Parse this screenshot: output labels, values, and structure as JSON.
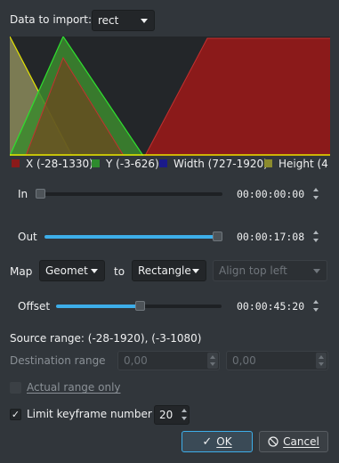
{
  "import_label": "Data to import:",
  "import_value": "rect",
  "chart": {
    "legend": [
      {
        "label": "X (-28-1330)",
        "color": "#8b1a1a"
      },
      {
        "label": "Y (-3-626)",
        "color": "#2e8b2e"
      },
      {
        "label": "Width (727-1920)",
        "color": "#1a1a8b"
      },
      {
        "label": "Height (4",
        "color": "#8b8b2e"
      }
    ]
  },
  "in": {
    "label": "In",
    "time": "00:00:00:00",
    "position": 0.0
  },
  "out": {
    "label": "Out",
    "time": "00:00:17:08",
    "position": 1.0
  },
  "map": {
    "label": "Map",
    "source": "Geomet",
    "to_label": "to",
    "target": "Rectangle",
    "align": "Align top left"
  },
  "offset": {
    "label": "Offset",
    "time": "00:00:45:20",
    "position": 0.5
  },
  "source_range": "Source range: (-28-1920), (-3-1080)",
  "destination": {
    "label": "Destination range",
    "min": "0,00",
    "max": "0,00"
  },
  "actual_range": {
    "label": "Actual range only",
    "checked": false
  },
  "limit": {
    "label": "Limit keyframe number",
    "checked": true,
    "check_glyph": "✓",
    "value": "20"
  },
  "buttons": {
    "ok": "OK",
    "ok_icon": "check-icon",
    "cancel": "Cancel",
    "cancel_icon": "cancel-circle-icon"
  }
}
